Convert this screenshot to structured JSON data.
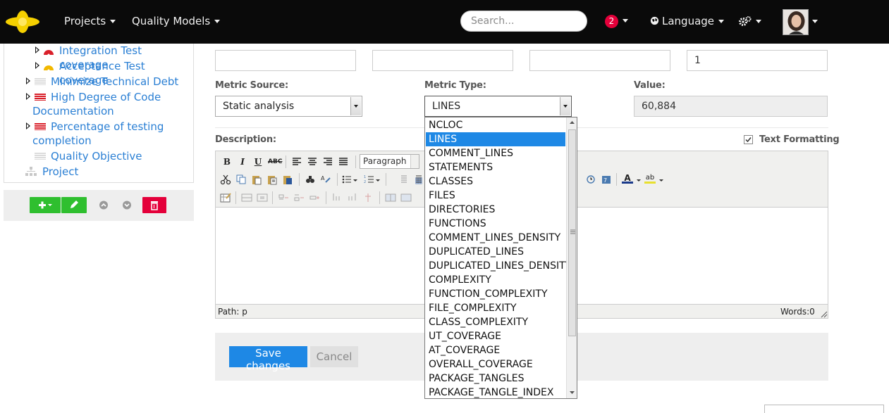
{
  "navbar": {
    "menu": [
      {
        "label": "Projects"
      },
      {
        "label": "Quality Models"
      }
    ],
    "search_placeholder": "Search...",
    "notifications_count": "2",
    "language_label": "Language",
    "accent": "#e4003a"
  },
  "tree": {
    "items": [
      {
        "label": "Integration Test coverage"
      },
      {
        "label": "Acceptance Test coverage"
      },
      {
        "label": "Minimize Technical Debt"
      },
      {
        "label": "High Degree of Code"
      },
      {
        "label": "Documentation"
      },
      {
        "label": "Percentage of testing"
      },
      {
        "label": "completion"
      },
      {
        "label": "Quality Objective"
      },
      {
        "label": "Project"
      }
    ]
  },
  "form": {
    "top_value_4": "1",
    "metric_source_label": "Metric Source:",
    "metric_source_value": "Static analysis",
    "metric_type_label": "Metric Type:",
    "metric_type_value": "LINES",
    "value_label": "Value:",
    "value_value": "60,884",
    "description_label": "Description:",
    "text_formatting_label": "Text Formatting",
    "editor_format": "Paragraph",
    "editor_path": "Path: p",
    "editor_words": "Words:0",
    "save_label": "Save changes",
    "cancel_label": "Cancel"
  },
  "metric_type_options": [
    "NCLOC",
    "LINES",
    "COMMENT_LINES",
    "STATEMENTS",
    "CLASSES",
    "FILES",
    "DIRECTORIES",
    "FUNCTIONS",
    "COMMENT_LINES_DENSITY",
    "DUPLICATED_LINES",
    "DUPLICATED_LINES_DENSITY",
    "COMPLEXITY",
    "FUNCTION_COMPLEXITY",
    "FILE_COMPLEXITY",
    "CLASS_COMPLEXITY",
    "UT_COVERAGE",
    "AT_COVERAGE",
    "OVERALL_COVERAGE",
    "PACKAGE_TANGLES",
    "PACKAGE_TANGLE_INDEX"
  ],
  "selected_option_index": 1,
  "colors": {
    "primary": "#1e88e5",
    "success": "#2fbf2f",
    "danger": "#e4003a"
  }
}
